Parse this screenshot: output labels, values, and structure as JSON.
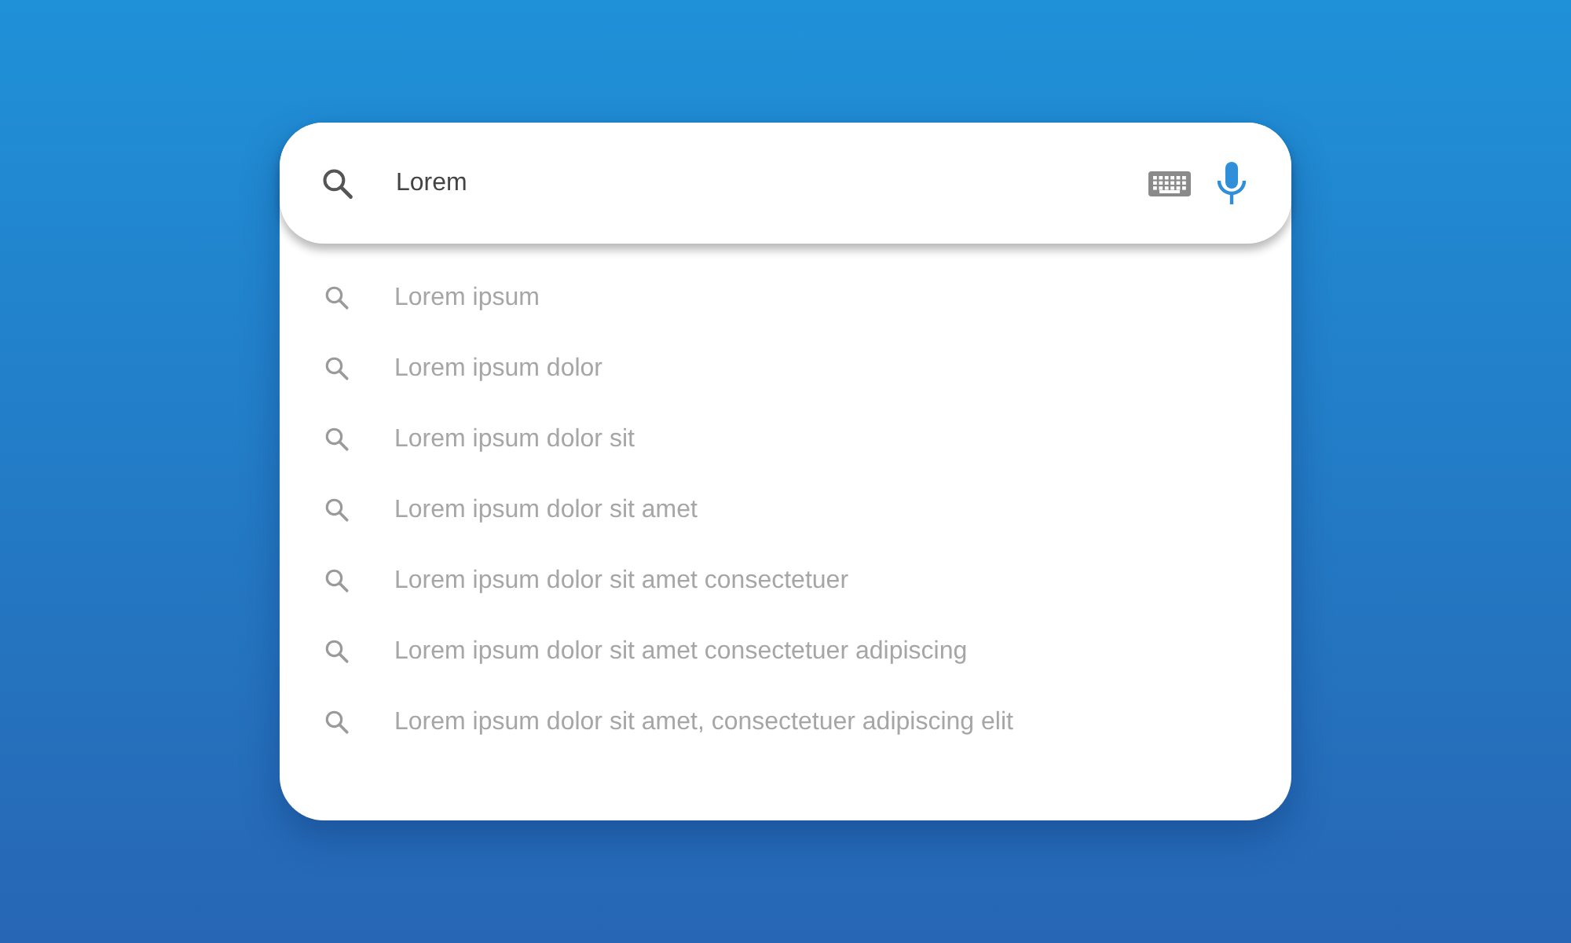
{
  "search": {
    "value": "Lorem"
  },
  "suggestions": [
    "Lorem ipsum",
    "Lorem ipsum dolor",
    "Lorem ipsum dolor sit",
    "Lorem ipsum dolor sit amet",
    "Lorem ipsum dolor sit amet consectetuer",
    "Lorem ipsum dolor sit amet consectetuer adipiscing",
    "Lorem ipsum dolor sit amet, consectetuer adipiscing elit"
  ]
}
